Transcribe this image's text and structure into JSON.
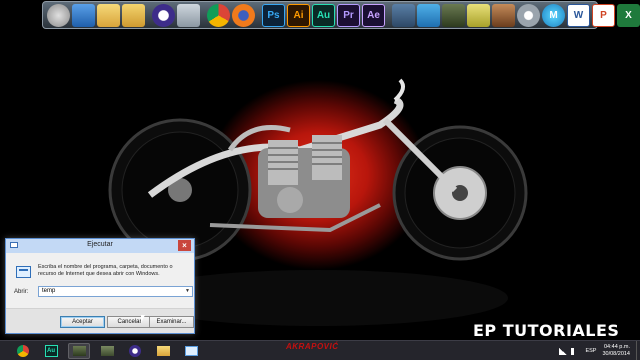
{
  "dock": {
    "icons": [
      {
        "name": "disc-drive-icon",
        "label": ""
      },
      {
        "name": "monitor-icon",
        "label": ""
      },
      {
        "name": "folder-icon",
        "label": ""
      },
      {
        "name": "folder-icon",
        "label": ""
      },
      {
        "name": "media-player-icon",
        "label": ""
      },
      {
        "name": "recycle-bin-icon",
        "label": ""
      },
      {
        "name": "chrome-icon",
        "label": ""
      },
      {
        "name": "firefox-icon",
        "label": ""
      },
      {
        "name": "photoshop-icon",
        "label": "Ps"
      },
      {
        "name": "illustrator-icon",
        "label": "Ai"
      },
      {
        "name": "audition-icon",
        "label": "Au"
      },
      {
        "name": "premiere-icon",
        "label": "Pr"
      },
      {
        "name": "after-effects-icon",
        "label": "Ae"
      },
      {
        "name": "windows-store-icon",
        "label": ""
      },
      {
        "name": "play-arrow-icon",
        "label": ""
      },
      {
        "name": "gpu-card-icon",
        "label": ""
      },
      {
        "name": "pencil-icon",
        "label": ""
      },
      {
        "name": "game-character-icon",
        "label": ""
      },
      {
        "name": "settings-gear-icon",
        "label": ""
      },
      {
        "name": "malwarebytes-icon",
        "label": "M"
      },
      {
        "name": "word-icon",
        "label": "W"
      },
      {
        "name": "powerpoint-icon",
        "label": "P"
      },
      {
        "name": "excel-icon",
        "label": "X"
      }
    ]
  },
  "dialog": {
    "title": "Ejecutar",
    "close": "×",
    "description": "Escriba el nombre del programa, carpeta, documento o recurso de Internet que desea abrir con Windows.",
    "open_label": "Abrir:",
    "open_value": "temp",
    "ok_label": "Aceptar",
    "cancel_label": "Cancelar",
    "browse_label": "Examinar..."
  },
  "watermark": "EP TUTORIALES",
  "logo_text": "AKRAPOVIĆ",
  "taskbar": {
    "items": [
      {
        "name": "taskbar-chrome",
        "active": false
      },
      {
        "name": "taskbar-audition",
        "active": false
      },
      {
        "name": "taskbar-gpu-tool",
        "active": true
      },
      {
        "name": "taskbar-gpu-tool-2",
        "active": false
      },
      {
        "name": "taskbar-media",
        "active": false
      },
      {
        "name": "taskbar-file-explorer",
        "active": false
      },
      {
        "name": "taskbar-run",
        "active": false
      }
    ],
    "language": "ESP",
    "time": "04:44 p.m.",
    "date": "30/08/2014"
  },
  "colors": {
    "wallpaper_glow": "#c41a10",
    "dialog_title": "#c3d9f5",
    "close_button": "#c9463d"
  }
}
